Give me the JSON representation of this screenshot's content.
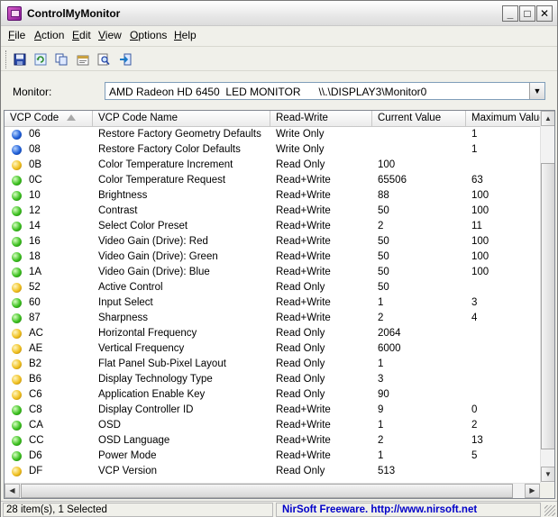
{
  "window": {
    "title": "ControlMyMonitor"
  },
  "window_controls": {
    "minimize": "_",
    "maximize": "□",
    "close": "✕"
  },
  "menu": [
    "File",
    "Action",
    "Edit",
    "View",
    "Options",
    "Help"
  ],
  "toolbar": {
    "icons": [
      "save-icon",
      "refresh-icon",
      "copy-icon",
      "properties-icon",
      "find-icon",
      "exit-icon"
    ]
  },
  "monitor": {
    "label": "Monitor:",
    "value": "AMD Radeon HD 6450  LED MONITOR      \\\\.\\DISPLAY3\\Monitor0"
  },
  "table": {
    "columns": [
      "VCP Code",
      "VCP Code Name",
      "Read-Write",
      "Current Value",
      "Maximum Value"
    ],
    "rows": [
      {
        "status": "blue",
        "code": "06",
        "name": "Restore Factory Geometry Defaults",
        "rw": "Write Only",
        "current": "",
        "max": "1"
      },
      {
        "status": "blue",
        "code": "08",
        "name": "Restore Factory Color Defaults",
        "rw": "Write Only",
        "current": "",
        "max": "1"
      },
      {
        "status": "yellow",
        "code": "0B",
        "name": "Color Temperature Increment",
        "rw": "Read Only",
        "current": "100",
        "max": ""
      },
      {
        "status": "green",
        "code": "0C",
        "name": "Color Temperature Request",
        "rw": "Read+Write",
        "current": "65506",
        "max": "63"
      },
      {
        "status": "green",
        "code": "10",
        "name": "Brightness",
        "rw": "Read+Write",
        "current": "88",
        "max": "100"
      },
      {
        "status": "green",
        "code": "12",
        "name": "Contrast",
        "rw": "Read+Write",
        "current": "50",
        "max": "100"
      },
      {
        "status": "green",
        "code": "14",
        "name": "Select Color Preset",
        "rw": "Read+Write",
        "current": "2",
        "max": "11"
      },
      {
        "status": "green",
        "code": "16",
        "name": "Video Gain (Drive): Red",
        "rw": "Read+Write",
        "current": "50",
        "max": "100"
      },
      {
        "status": "green",
        "code": "18",
        "name": "Video Gain (Drive): Green",
        "rw": "Read+Write",
        "current": "50",
        "max": "100"
      },
      {
        "status": "green",
        "code": "1A",
        "name": "Video Gain (Drive): Blue",
        "rw": "Read+Write",
        "current": "50",
        "max": "100"
      },
      {
        "status": "yellow",
        "code": "52",
        "name": "Active Control",
        "rw": "Read Only",
        "current": "50",
        "max": ""
      },
      {
        "status": "green",
        "code": "60",
        "name": "Input Select",
        "rw": "Read+Write",
        "current": "1",
        "max": "3"
      },
      {
        "status": "green",
        "code": "87",
        "name": "Sharpness",
        "rw": "Read+Write",
        "current": "2",
        "max": "4"
      },
      {
        "status": "yellow",
        "code": "AC",
        "name": "Horizontal Frequency",
        "rw": "Read Only",
        "current": "2064",
        "max": ""
      },
      {
        "status": "yellow",
        "code": "AE",
        "name": "Vertical Frequency",
        "rw": "Read Only",
        "current": "6000",
        "max": ""
      },
      {
        "status": "yellow",
        "code": "B2",
        "name": "Flat Panel Sub-Pixel Layout",
        "rw": "Read Only",
        "current": "1",
        "max": ""
      },
      {
        "status": "yellow",
        "code": "B6",
        "name": "Display Technology Type",
        "rw": "Read Only",
        "current": "3",
        "max": ""
      },
      {
        "status": "yellow",
        "code": "C6",
        "name": "Application Enable Key",
        "rw": "Read Only",
        "current": "90",
        "max": ""
      },
      {
        "status": "green",
        "code": "C8",
        "name": "Display Controller ID",
        "rw": "Read+Write",
        "current": "9",
        "max": "0"
      },
      {
        "status": "green",
        "code": "CA",
        "name": "OSD",
        "rw": "Read+Write",
        "current": "1",
        "max": "2"
      },
      {
        "status": "green",
        "code": "CC",
        "name": "OSD Language",
        "rw": "Read+Write",
        "current": "2",
        "max": "13"
      },
      {
        "status": "green",
        "code": "D6",
        "name": "Power Mode",
        "rw": "Read+Write",
        "current": "1",
        "max": "5"
      },
      {
        "status": "yellow",
        "code": "DF",
        "name": "VCP Version",
        "rw": "Read Only",
        "current": "513",
        "max": ""
      }
    ]
  },
  "status": {
    "left": "28 item(s), 1 Selected",
    "right": "NirSoft Freeware.  http://www.nirsoft.net"
  }
}
